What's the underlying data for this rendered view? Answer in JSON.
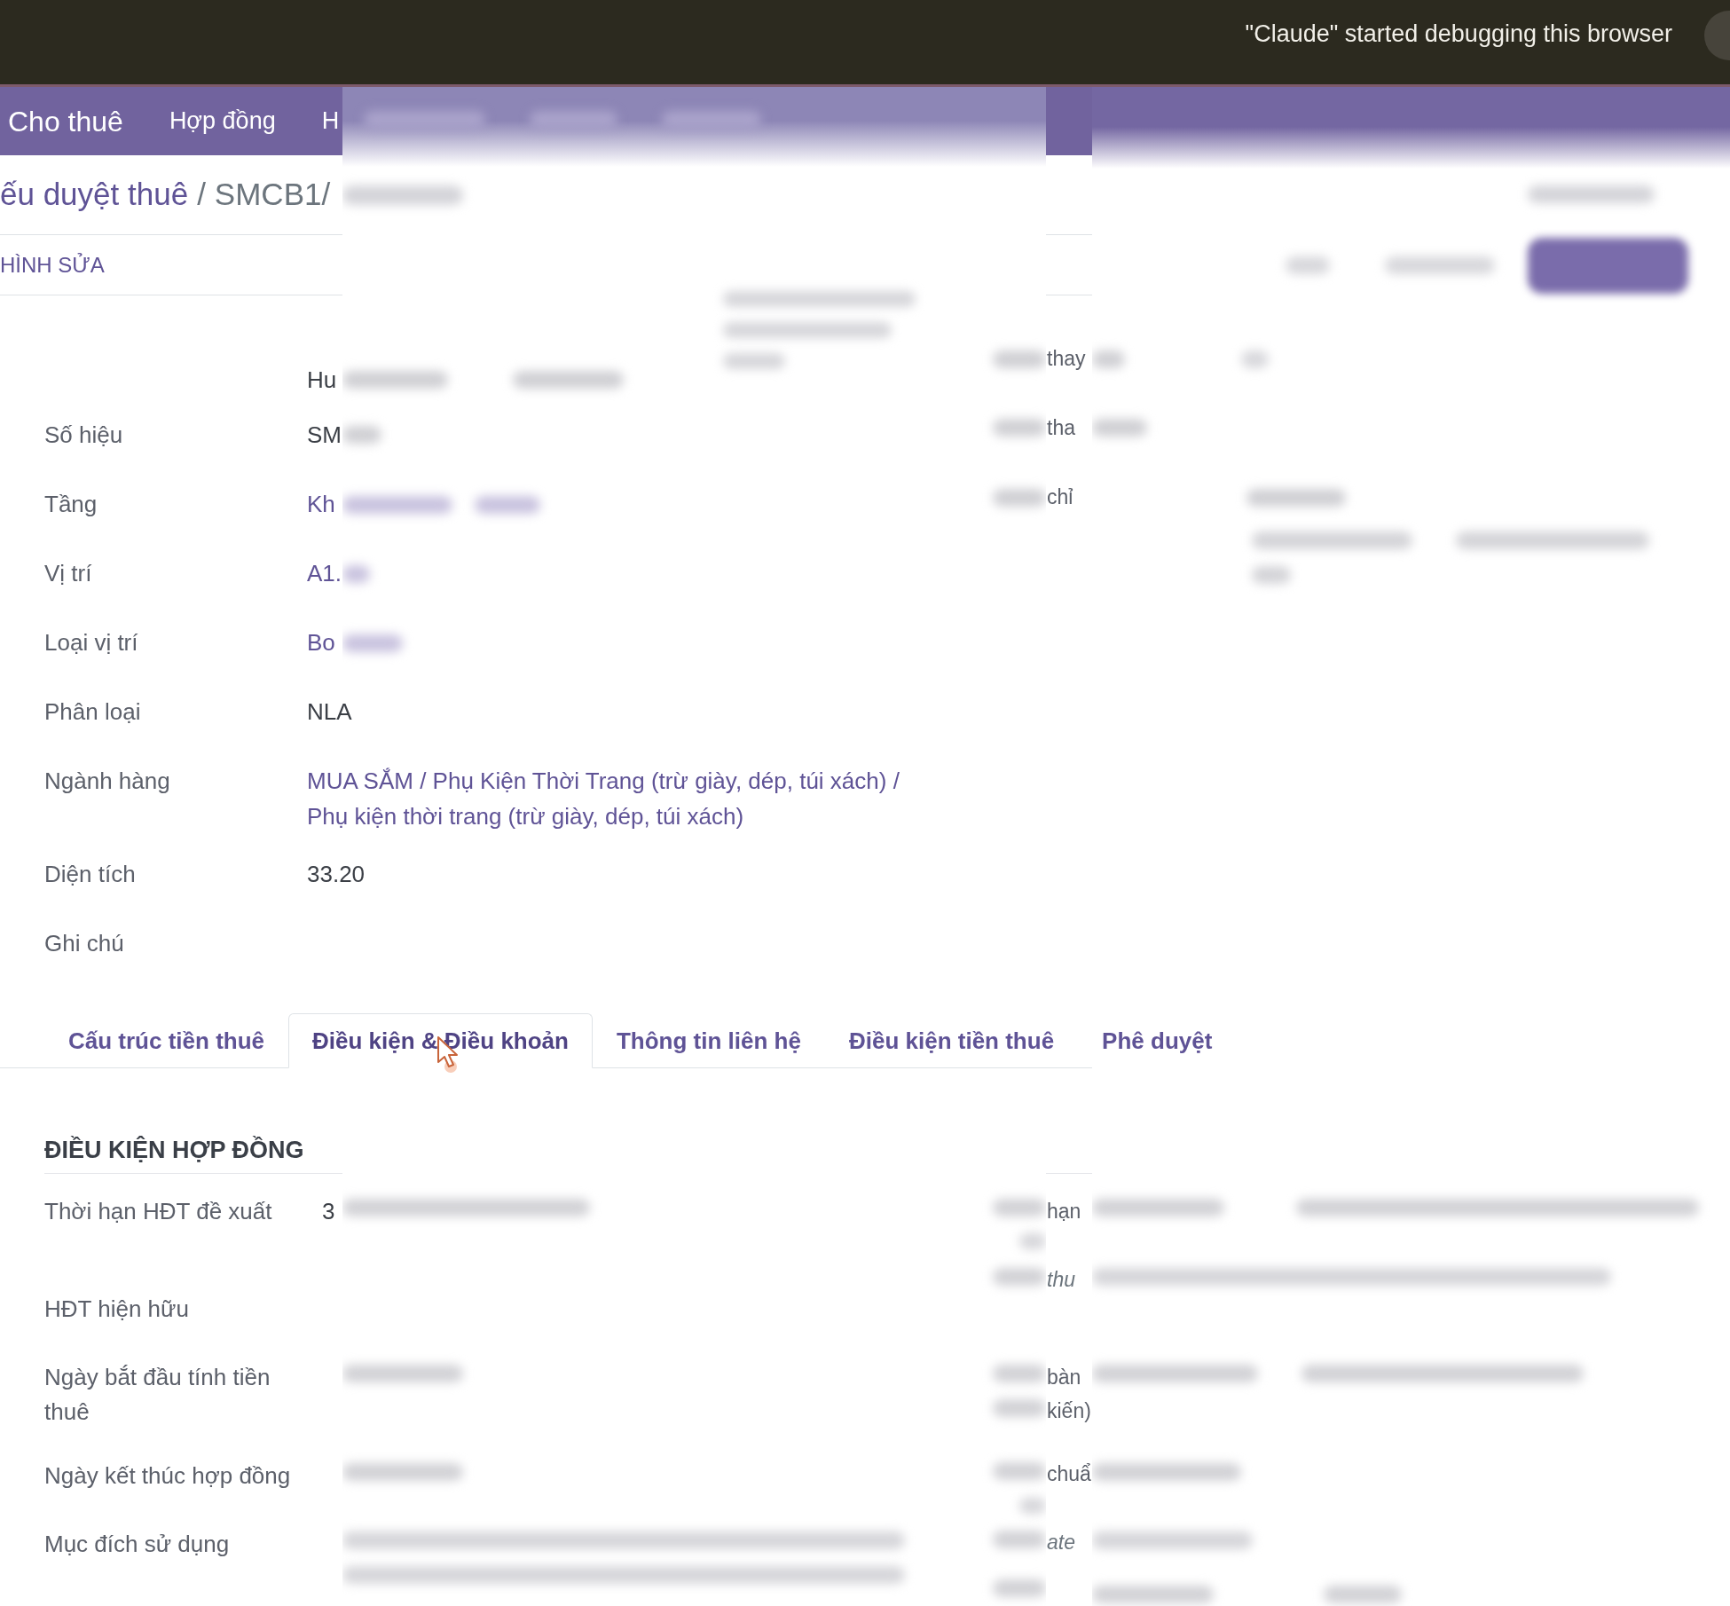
{
  "debug_banner": {
    "message": "\"Claude\" started debugging this browser"
  },
  "navbar": {
    "app_name": "Cho thuê",
    "menu_items": [
      "Hợp đồng",
      "H"
    ]
  },
  "breadcrumb": {
    "parent": "ếu duyệt thuê",
    "separator": "/",
    "current": "SMCB1/"
  },
  "control_bar": {
    "edit_button": "HÌNH SỬA"
  },
  "fields": [
    {
      "value": "Hu",
      "kind": "text"
    },
    {
      "label": "Số hiệu",
      "value": "SM",
      "kind": "text"
    },
    {
      "label": "Tầng",
      "value": "Kh",
      "kind": "link"
    },
    {
      "label": "Vị trí",
      "value": "A1.",
      "kind": "link"
    },
    {
      "label": "Loại vị trí",
      "value": "Bo",
      "kind": "link"
    },
    {
      "label": "Phân loại",
      "value": "NLA",
      "kind": "text"
    },
    {
      "label": "Ngành hàng",
      "value": "MUA SẮM / Phụ Kiện Thời Trang (trừ giày, dép, túi xách) / Phụ kiện thời trang (trừ giày, dép, túi xách)",
      "kind": "link"
    },
    {
      "label": "Diện tích",
      "value": "33.20",
      "kind": "text"
    },
    {
      "label": "Ghi chú"
    }
  ],
  "right_column_fragments": [
    "thay",
    "tha",
    "chỉ"
  ],
  "tabs": [
    {
      "label": "Cấu trúc tiền thuê",
      "selected": false
    },
    {
      "label": "Điều kiện & Điều khoản",
      "selected": true
    },
    {
      "label": "Thông tin liên hệ",
      "selected": false
    },
    {
      "label": "Điều kiện tiền thuê",
      "selected": false
    },
    {
      "label": "Phê duyệt",
      "selected": false
    }
  ],
  "contract_section": {
    "title": "ĐIỀU KIỆN HỢP ĐỒNG",
    "fields": [
      {
        "label": "Thời hạn HĐT đề xuất",
        "value": "3"
      },
      {
        "label": "HĐT hiện hữu"
      },
      {
        "label": "Ngày bắt đầu tính tiền thuê"
      },
      {
        "label": "Ngày kết thúc hợp đồng"
      },
      {
        "label": "Mục đích sử dụng"
      }
    ],
    "right_fragments": [
      {
        "text": "hạn",
        "kind": "label"
      },
      {
        "text": "thu",
        "kind": "help"
      },
      {
        "text": "bàn",
        "kind": "label"
      },
      {
        "text": "kiến)",
        "kind": "label"
      },
      {
        "text": "chuẩ",
        "kind": "label"
      },
      {
        "text": "ate",
        "kind": "help"
      }
    ]
  }
}
